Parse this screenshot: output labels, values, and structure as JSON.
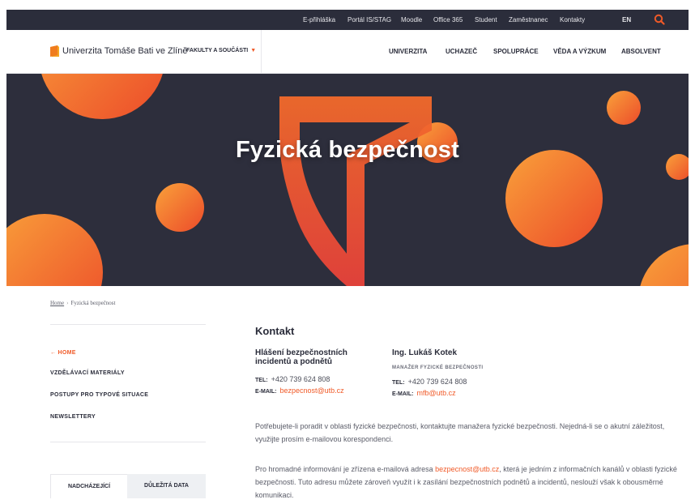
{
  "topbar": {
    "links": [
      "E-přihláška",
      "Portál IS/STAG",
      "Moodle",
      "Office 365",
      "Student",
      "Zaměstnanec",
      "Kontakty"
    ],
    "lang": "EN",
    "search_icon": "search-icon"
  },
  "header": {
    "brand": "Univerzita Tomáše Bati ve Zlíně",
    "faculties": "FAKULTY A SOUČÁSTI",
    "faculties_caret": "▼",
    "nav": [
      "UNIVERZITA",
      "UCHAZEČ",
      "SPOLUPRÁCE",
      "VĚDA A VÝZKUM",
      "ABSOLVENT"
    ]
  },
  "hero": {
    "title": "Fyzická bezpečnost"
  },
  "breadcrumb": {
    "home": "Home",
    "separator": "›",
    "current": "Fyzická bezpečnost"
  },
  "sidebar": {
    "back": "← HOME",
    "items": [
      "VZDĚLÁVACÍ MATERIÁLY",
      "POSTUPY PRO TYPOVÉ SITUACE",
      "NEWSLETTERY"
    ],
    "tabs": [
      "NADCHÁZEJÍCÍ",
      "DŮLEŽITÁ DATA"
    ]
  },
  "content": {
    "heading": "Kontakt",
    "contact_left": {
      "title_line1": "Hlášení bezpečnostních",
      "title_line2": "incidentů a podnětů",
      "tel_label": "TEL:",
      "tel": "+420 739 624 808",
      "email_label": "E-MAIL:",
      "email": "bezpecnost@utb.cz"
    },
    "contact_right": {
      "name": "Ing. Lukáš Kotek",
      "role": "MANAŽER FYZICKÉ BEZPEČNOSTI",
      "tel_label": "TEL:",
      "tel": "+420 739 624 808",
      "email_label": "E-MAIL:",
      "email": "mfb@utb.cz"
    },
    "para1": "Potřebujete-li poradit v oblasti fyzické bezpečnosti, kontaktujte manažera fyzické bezpečnosti. Nejedná-li se o akutní záležitost, využijte prosím e-mailovou korespondenci.",
    "para2_before": "Pro hromadné informování je zřízena e-mailová adresa ",
    "para2_link": "bezpecnost@utb.cz",
    "para2_after": ", která je jedním z informačních kanálů v oblasti fyzické bezpečnosti. Tuto adresu můžete zároveň využít i k zasílání bezpečnostních podnětů a incidentů, neslouží však k obousměrné komunikaci."
  },
  "colors": {
    "accent": "#f05a28",
    "dark": "#2b2d3b",
    "hero_bg": "#2d2e3c"
  }
}
